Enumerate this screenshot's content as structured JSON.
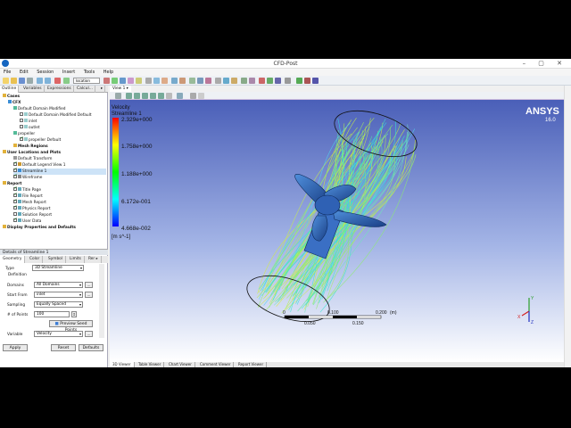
{
  "window": {
    "title": "CFD-Post",
    "buttons": "–  ▢  ✕"
  },
  "menu": [
    "File",
    "Edit",
    "Session",
    "Insert",
    "Tools",
    "Help"
  ],
  "toolbar": {
    "location_label": "location"
  },
  "left_tabs": [
    "Outline",
    "Variables",
    "Expressions",
    "Calcul...",
    "▸"
  ],
  "tree": [
    {
      "label": "Cases",
      "bold": true
    },
    {
      "label": "CFX",
      "bold": true
    },
    {
      "label": "Default Domain Modified"
    },
    {
      "label": "Default Domain Modified Default"
    },
    {
      "label": "inlet"
    },
    {
      "label": "outlet"
    },
    {
      "label": "propeller"
    },
    {
      "label": "propeller Default"
    },
    {
      "label": "Mesh Regions",
      "bold": true
    },
    {
      "label": "User Locations and Plots",
      "bold": true
    },
    {
      "label": "Default Transform"
    },
    {
      "label": "Default Legend View 1"
    },
    {
      "label": "Streamline 1"
    },
    {
      "label": "Wireframe"
    },
    {
      "label": "Report",
      "bold": true
    },
    {
      "label": "Title Page"
    },
    {
      "label": "File Report"
    },
    {
      "label": "Mesh Report"
    },
    {
      "label": "Physics Report"
    },
    {
      "label": "Solution Report"
    },
    {
      "label": "User Data"
    },
    {
      "label": "Display Properties and Defaults",
      "bold": true
    }
  ],
  "details": {
    "header": "Details of Streamline 1",
    "tabs": [
      "Geometry",
      "Color",
      "Symbol",
      "Limits",
      "Rer ▸"
    ],
    "type_label": "Type",
    "type_value": "3D Streamline",
    "definition_label": "Definition",
    "domains_label": "Domains",
    "domains_value": "All Domains",
    "start_from_label": "Start From",
    "start_from_value": "inlet",
    "sampling_label": "Sampling",
    "sampling_value": "Equally Spaced",
    "points_label": "# of Points",
    "points_value": "100",
    "preview_button": "Preview Seed Points",
    "variable_label": "Variable",
    "variable_value": "Velocity"
  },
  "buttons": {
    "apply": "Apply",
    "reset": "Reset",
    "defaults": "Defaults"
  },
  "viewer": {
    "tab_label": "View 1 ▾",
    "legend_title": "Velocity",
    "legend_subtitle": "Streamline 1",
    "legend_ticks": [
      "2.329e+000",
      "1.758e+000",
      "1.188e+000",
      "6.172e-001",
      "4.668e-002"
    ],
    "legend_unit": "[m s^-1]",
    "brand": "ANSYS",
    "version": "16.0",
    "scale_top": [
      "0",
      "0.100",
      "0.200",
      "(m)"
    ],
    "scale_bottom": [
      "0.050",
      "0.150"
    ],
    "axis_labels": [
      "Y",
      "Z",
      "X"
    ]
  },
  "viewer_tabs": [
    "3D Viewer",
    "Table Viewer",
    "Chart Viewer",
    "Comment Viewer",
    "Report Viewer"
  ],
  "colors": {
    "background_top": "#4a5fb8",
    "background_bottom": "#ffffff",
    "selection": "#cde3f7"
  }
}
